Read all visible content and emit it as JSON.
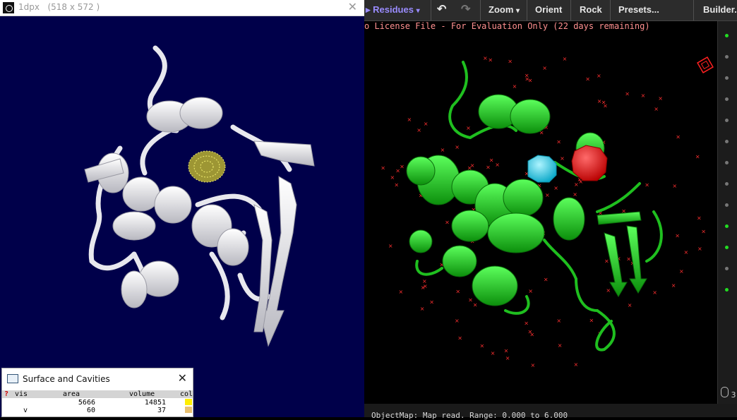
{
  "left_window": {
    "title": "1dpx",
    "size_text": "(518 x 572 )",
    "close_glyph": "✕"
  },
  "cavities_panel": {
    "title": "Surface and Cavities",
    "close_glyph": "✕",
    "help_glyph": "?",
    "columns": [
      "vis",
      "area",
      "volume",
      "col"
    ],
    "rows": [
      {
        "vis": "",
        "area": "5666",
        "volume": "14851",
        "color": "#ffee00"
      },
      {
        "vis": "v",
        "area": "60",
        "volume": "37",
        "color": "#e8c070"
      }
    ]
  },
  "pymol": {
    "toolbar": {
      "residues": "Residues",
      "zoom": "Zoom",
      "orient": "Orient",
      "rock": "Rock",
      "presets": "Presets...",
      "builder": "Builder."
    },
    "license_message": "o License File - For Evaluation Only (22 days remaining)",
    "status_message": "ObjectMap: Map read.  Range: 0.000 to 6.000",
    "side_label": "3",
    "colors": {
      "protein": "#22cc22",
      "cavity_cyan": "#1ec8e0",
      "cavity_red": "#ee1111",
      "water": "#ff3030"
    }
  }
}
